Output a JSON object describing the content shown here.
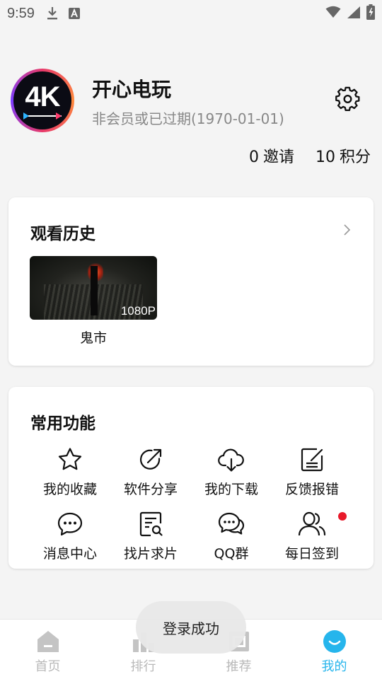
{
  "status_bar": {
    "time": "9:59"
  },
  "profile": {
    "avatar_text": "4K",
    "username": "开心电玩",
    "member_status": "非会员或已过期(1970-01-01)"
  },
  "stats": {
    "invites": {
      "value": "0",
      "label": "邀请"
    },
    "points": {
      "value": "10",
      "label": "积分"
    }
  },
  "history": {
    "title": "观看历史",
    "items": [
      {
        "title": "鬼市",
        "quality": "1080P"
      }
    ]
  },
  "functions": {
    "title": "常用功能",
    "items": [
      {
        "label": "我的收藏",
        "icon": "star-icon"
      },
      {
        "label": "软件分享",
        "icon": "share-icon"
      },
      {
        "label": "我的下载",
        "icon": "cloud-download-icon"
      },
      {
        "label": "反馈报错",
        "icon": "feedback-edit-icon"
      },
      {
        "label": "消息中心",
        "icon": "chat-bubble-icon"
      },
      {
        "label": "找片求片",
        "icon": "search-document-icon"
      },
      {
        "label": "QQ群",
        "icon": "group-chat-icon"
      },
      {
        "label": "每日签到",
        "icon": "users-icon"
      }
    ]
  },
  "toast": {
    "text": "登录成功"
  },
  "bottom_nav": {
    "items": [
      {
        "label": "首页",
        "active": false
      },
      {
        "label": "排行",
        "active": false
      },
      {
        "label": "推荐",
        "active": false
      },
      {
        "label": "我的",
        "active": true
      }
    ]
  },
  "colors": {
    "accent": "#26b5ec",
    "notification_dot": "#e8192a",
    "inactive_nav": "#b9b9b9"
  }
}
